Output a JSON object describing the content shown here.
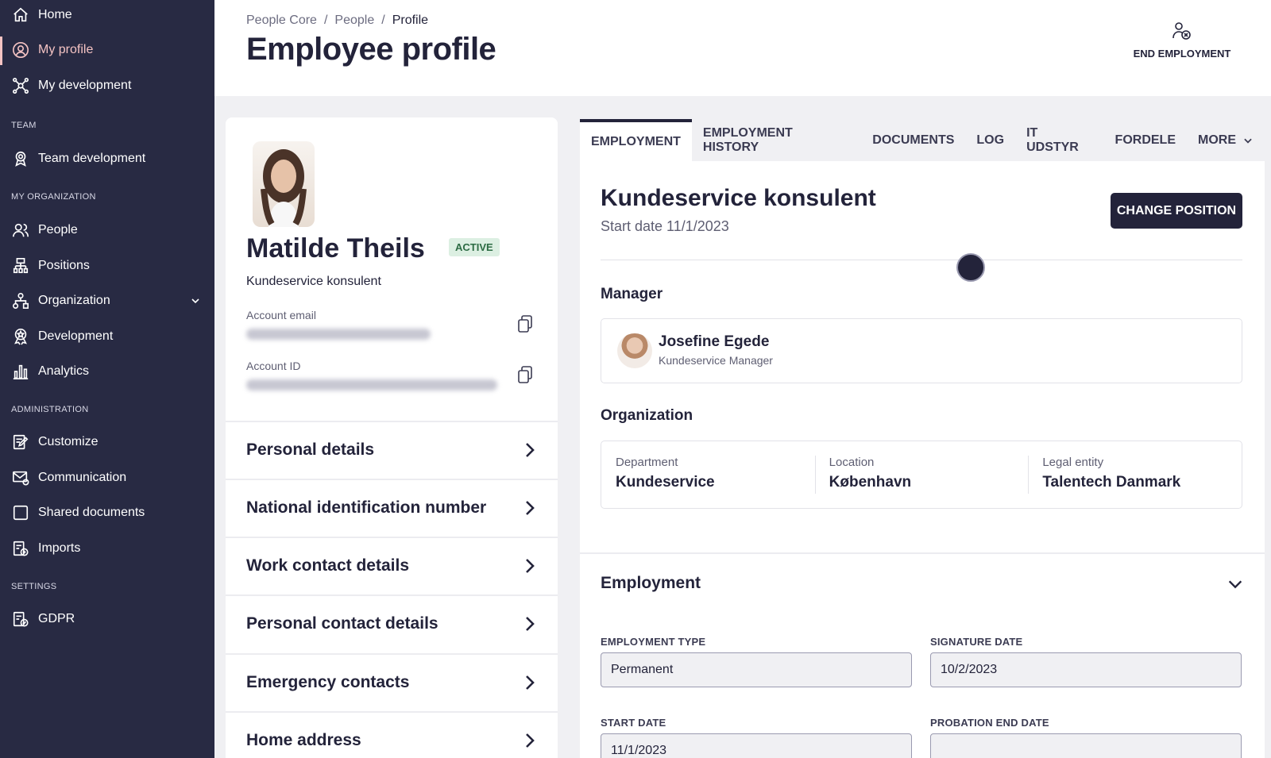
{
  "sidebar": {
    "items_top": [
      {
        "label": "Home",
        "icon": "home-icon"
      },
      {
        "label": "My profile",
        "icon": "user-circle-icon"
      },
      {
        "label": "My development",
        "icon": "network-icon"
      }
    ],
    "section_team": "TEAM",
    "team_items": [
      {
        "label": "Team development",
        "icon": "award-icon"
      }
    ],
    "section_org": "MY ORGANIZATION",
    "org_items": [
      {
        "label": "People",
        "icon": "people-icon"
      },
      {
        "label": "Positions",
        "icon": "hierarchy-icon"
      },
      {
        "label": "Organization",
        "icon": "org-chart-icon"
      },
      {
        "label": "Development",
        "icon": "ribbon-icon"
      },
      {
        "label": "Analytics",
        "icon": "bar-chart-icon"
      }
    ],
    "section_admin": "ADMINISTRATION",
    "admin_items": [
      {
        "label": "Customize",
        "icon": "edit-icon"
      },
      {
        "label": "Communication",
        "icon": "mail-icon"
      },
      {
        "label": "Shared documents",
        "icon": "document-icon"
      },
      {
        "label": "Imports",
        "icon": "import-icon"
      }
    ],
    "section_settings": "SETTINGS",
    "settings_items": [
      {
        "label": "GDPR",
        "icon": "gdpr-icon"
      }
    ]
  },
  "header": {
    "breadcrumb": [
      "People Core",
      "/",
      "People",
      "/",
      "Profile"
    ],
    "title": "Employee profile",
    "end_employment": "END EMPLOYMENT"
  },
  "profile": {
    "name": "Matilde Theils",
    "status": "ACTIVE",
    "role": "Kundeservice konsulent",
    "email_label": "Account email",
    "id_label": "Account ID",
    "rows": [
      "Personal details",
      "National identification number",
      "Work contact details",
      "Personal contact details",
      "Emergency contacts",
      "Home address"
    ]
  },
  "tabs": [
    "EMPLOYMENT",
    "EMPLOYMENT HISTORY",
    "DOCUMENTS",
    "LOG",
    "IT UDSTYR",
    "FORDELE",
    "MORE"
  ],
  "position": {
    "title": "Kundeservice konsulent",
    "start": "Start date 11/1/2023",
    "change_button": "CHANGE POSITION"
  },
  "manager": {
    "heading": "Manager",
    "name": "Josefine Egede",
    "role": "Kundeservice Manager"
  },
  "organization": {
    "heading": "Organization",
    "department_label": "Department",
    "department": "Kundeservice",
    "location_label": "Location",
    "location": "København",
    "legal_label": "Legal entity",
    "legal": "Talentech Danmark"
  },
  "employment": {
    "heading": "Employment",
    "type_label": "EMPLOYMENT TYPE",
    "type_value": "Permanent",
    "signature_label": "SIGNATURE DATE",
    "signature_value": "10/2/2023",
    "start_label": "START DATE",
    "start_value": "11/1/2023",
    "probation_label": "PROBATION END DATE",
    "probation_value": ""
  },
  "colors": {
    "sidebar_bg": "#282a43",
    "accent_active": "#f4c3c3",
    "primary_dark": "#23233a",
    "badge_bg": "#dcefe2"
  }
}
